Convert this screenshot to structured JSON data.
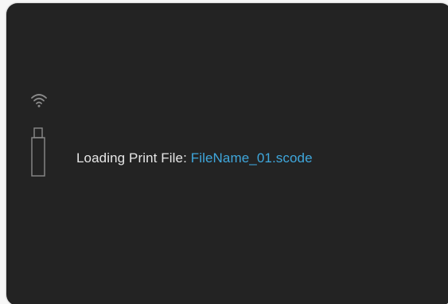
{
  "status": {
    "label": "Loading Print File:",
    "filename": "FileName_01.scode"
  },
  "icons": {
    "wifi": "wifi-icon",
    "usb": "usb-drive-icon"
  },
  "colors": {
    "screen_background": "#232323",
    "label_text": "#e6e6e6",
    "filename_text": "#3fa7dc",
    "icon": "#8a8a8a"
  }
}
